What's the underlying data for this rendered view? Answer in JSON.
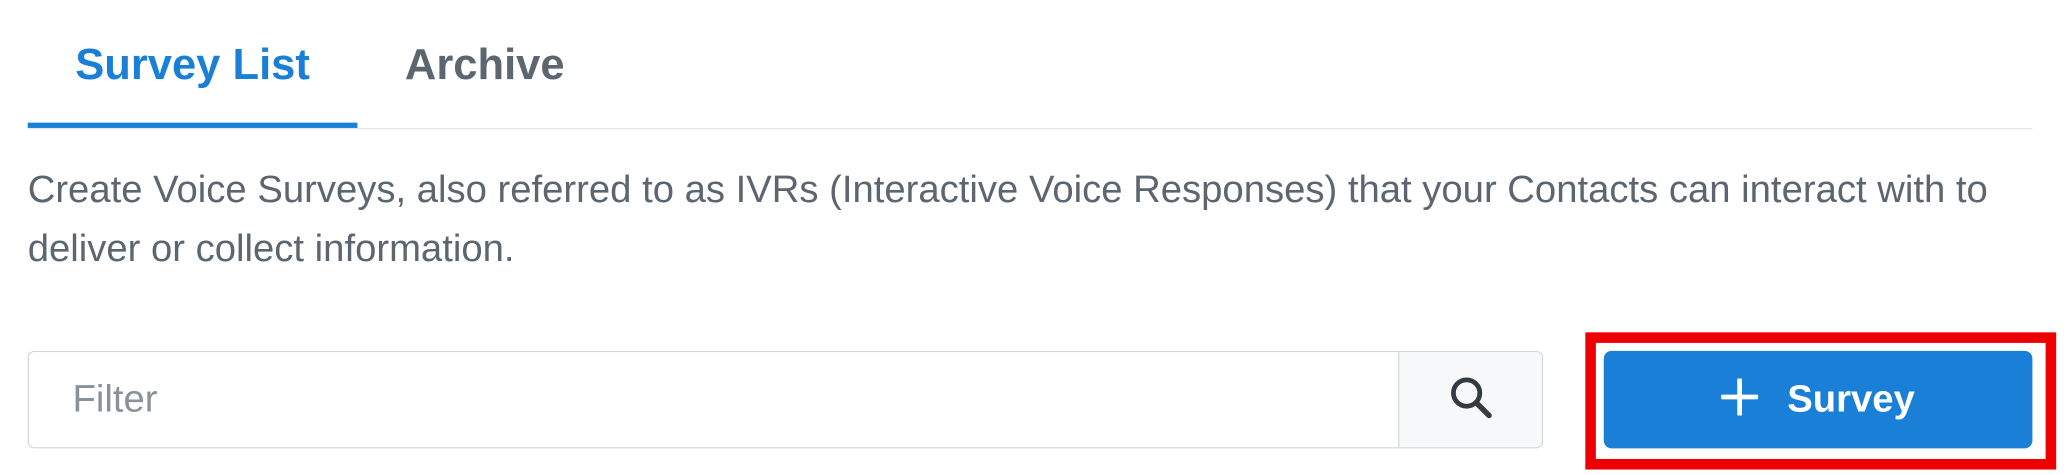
{
  "tabs": {
    "survey_list": "Survey List",
    "archive": "Archive",
    "active": "survey_list"
  },
  "description": "Create Voice Surveys, also referred to as IVRs (Interactive Voice Responses) that your Contacts can interact with to deliver or collect information.",
  "filter": {
    "placeholder": "Filter",
    "value": "",
    "search_icon": "search-icon"
  },
  "add_button": {
    "label": "Survey",
    "icon": "plus-icon",
    "highlighted": true
  },
  "colors": {
    "accent": "#1a7fd6",
    "text": "#5b6670",
    "highlight": "#ee0000"
  }
}
